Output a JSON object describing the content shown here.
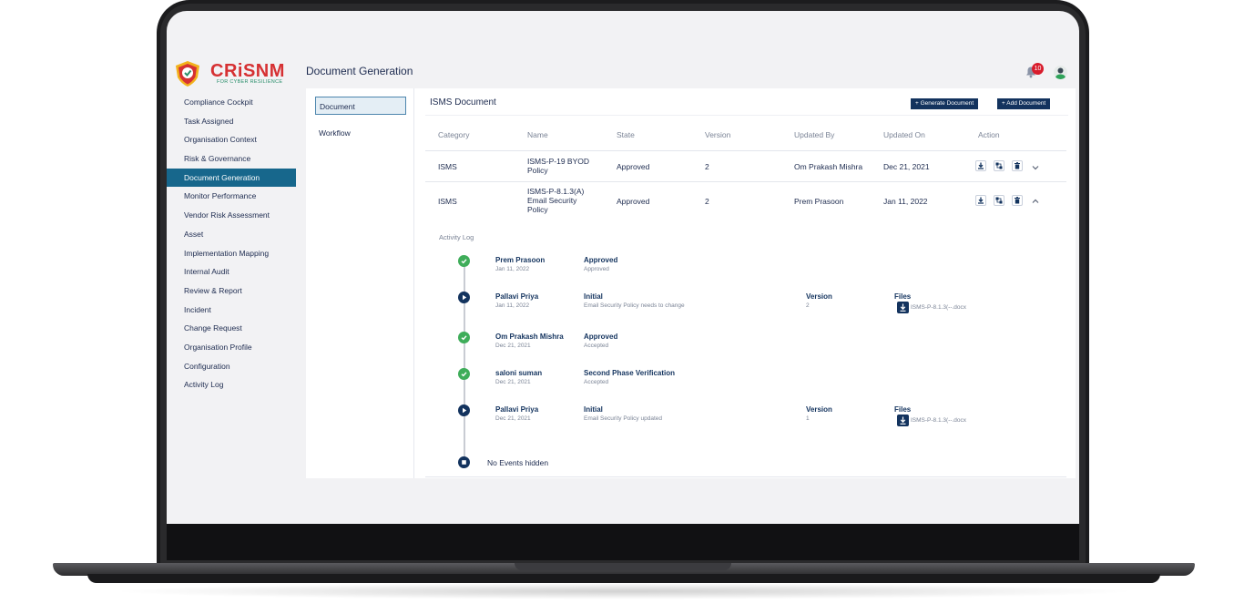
{
  "app": {
    "logo_text": "CRiSNM",
    "logo_tagline": "FOR CYBER RESILIENCE",
    "page_title": "Document Generation",
    "notification_count": "10"
  },
  "sidebar": {
    "items": [
      {
        "label": "Compliance Cockpit"
      },
      {
        "label": "Task Assigned"
      },
      {
        "label": "Organisation Context"
      },
      {
        "label": "Risk & Governance"
      },
      {
        "label": "Document Generation",
        "active": true
      },
      {
        "label": "Monitor Performance"
      },
      {
        "label": "Vendor Risk Assessment"
      },
      {
        "label": "Asset"
      },
      {
        "label": "Implementation Mapping"
      },
      {
        "label": "Internal Audit"
      },
      {
        "label": "Review & Report"
      },
      {
        "label": "Incident"
      },
      {
        "label": "Change Request"
      },
      {
        "label": "Organisation Profile"
      },
      {
        "label": "Configuration"
      },
      {
        "label": "Activity Log"
      }
    ]
  },
  "subnav": {
    "document": "Document",
    "workflow": "Workflow"
  },
  "main": {
    "title": "ISMS Document",
    "generate_button": "+ Generate Document",
    "add_button": "+ Add Document",
    "columns": [
      "Category",
      "Name",
      "State",
      "Version",
      "Updated By",
      "Updated On",
      "Action"
    ],
    "rows": [
      {
        "category": "ISMS",
        "name": "ISMS-P-19 BYOD Policy",
        "state": "Approved",
        "version": "2",
        "updated_by": "Om Prakash Mishra",
        "updated_on": "Dec 21, 2021"
      },
      {
        "category": "ISMS",
        "name": "ISMS-P-8.1.3(A) Email Security Policy",
        "state": "Approved",
        "version": "2",
        "updated_by": "Prem Prasoon",
        "updated_on": "Jan 11, 2022"
      }
    ]
  },
  "activity": {
    "title": "Activity Log",
    "events": [
      {
        "name": "Prem Prasoon",
        "date": "Jan 11, 2022",
        "status": "Approved",
        "note": "Approved"
      },
      {
        "name": "Pallavi Priya",
        "date": "Jan 11, 2022",
        "status": "Initial",
        "note": "Email Security Policy needs to change",
        "version_label": "Version",
        "version": "2",
        "files_label": "Files",
        "file": "ISMS-P-8.1.3(--.docx"
      },
      {
        "name": "Om Prakash Mishra",
        "date": "Dec 21, 2021",
        "status": "Approved",
        "note": "Accepted"
      },
      {
        "name": "saloni suman",
        "date": "Dec 21, 2021",
        "status": "Second Phase Verification",
        "note": "Accepted"
      },
      {
        "name": "Pallavi Priya",
        "date": "Dec 21, 2021",
        "status": "Initial",
        "note": "Email Security Policy updated",
        "version_label": "Version",
        "version": "1",
        "files_label": "Files",
        "file": "ISMS-P-8.1.3(--.docx"
      }
    ],
    "end_text": "No Events hidden"
  },
  "icons": {
    "logo": "shield-logo-icon",
    "notification": "bell-icon",
    "user": "user-avatar-icon",
    "download": "download-icon",
    "workflow": "workflow-icon",
    "delete": "trash-icon",
    "expand": "chevron-down-icon",
    "collapse": "chevron-up-icon",
    "approved": "check-circle-icon",
    "initial": "play-circle-icon",
    "end": "stop-circle-icon"
  },
  "colors": {
    "brand_red": "#d63133",
    "brand_navy": "#13335e",
    "sidebar_active": "#17678c",
    "success": "#3fad5a"
  }
}
